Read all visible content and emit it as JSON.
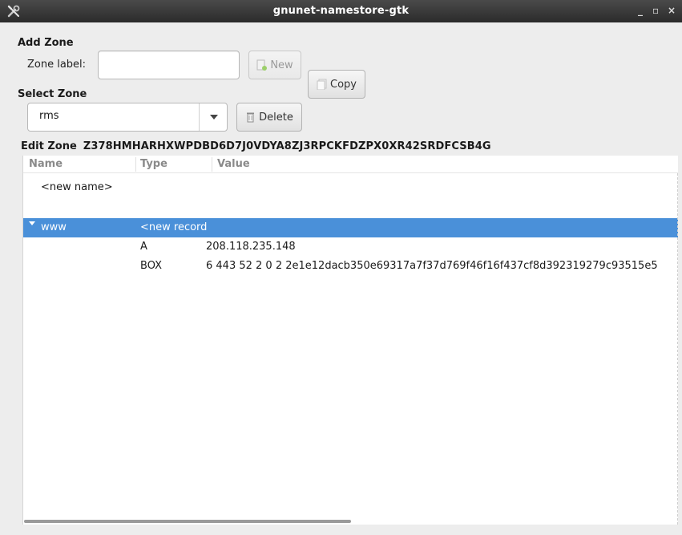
{
  "window": {
    "title": "gnunet-namestore-gtk",
    "controls": {
      "minimize": "_",
      "maximize": "▫",
      "close": "×"
    }
  },
  "add_zone": {
    "heading": "Add Zone",
    "label": "Zone label:",
    "input_value": "",
    "new_button": "New",
    "copy_button": "Copy"
  },
  "select_zone": {
    "heading": "Select Zone",
    "selected": "rms",
    "delete_button": "Delete"
  },
  "edit_zone": {
    "heading": "Edit Zone",
    "zone_key": "Z378HMHARHXWPDBD6D7J0VDYA8ZJ3RPCKFDZPX0XR42SRDFCSB4G"
  },
  "tree": {
    "columns": [
      "Name",
      "Type",
      "Value"
    ],
    "rows": [
      {
        "name": "<new name>",
        "type": "",
        "value": "",
        "selected": false
      },
      {
        "name": "www",
        "type": "<new record",
        "value": "",
        "selected": true
      },
      {
        "name": "",
        "type": "A",
        "value": "208.118.235.148",
        "selected": false
      },
      {
        "name": "",
        "type": "BOX",
        "value": "6 443 52 2 0 2 2e1e12dacb350e69317a7f37d769f46f16f437cf8d392319279c93515e5",
        "selected": false
      }
    ]
  },
  "colors": {
    "selection": "#4a90d9",
    "titlebar": "#2b2b2b",
    "background": "#ededed"
  },
  "icons": {
    "app": "tools-icon",
    "new": "new-document-icon",
    "copy": "copy-icon",
    "delete": "trash-icon",
    "combo": "chevron-down-icon"
  }
}
